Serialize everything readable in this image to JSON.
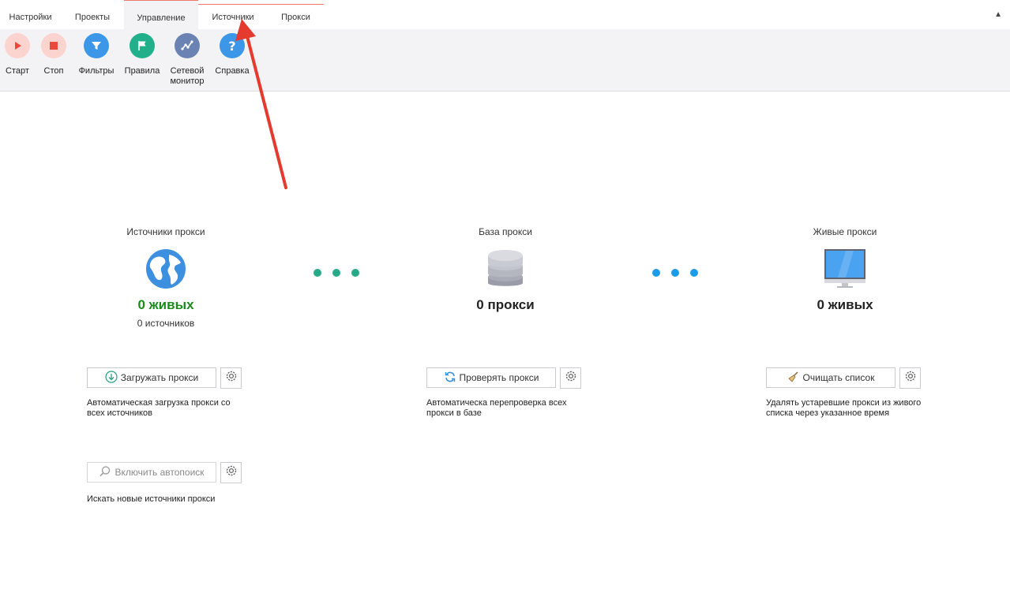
{
  "tabs": [
    "Настройки",
    "Проекты",
    "Управление",
    "Источники",
    "Прокси"
  ],
  "collapse_glyph": "▲",
  "ribbon": {
    "start": "Старт",
    "stop": "Стоп",
    "filters": "Фильтры",
    "rules": "Правила",
    "network_monitor_1": "Сетевой",
    "network_monitor_2": "монитор",
    "help": "Справка"
  },
  "sources": {
    "title": "Источники прокси",
    "alive": "0 живых",
    "count": "0 источников",
    "load_button": "Загружать прокси",
    "load_desc_1": "Автоматическая загрузка прокси со",
    "load_desc_2": "всех источников",
    "autosearch_button": "Включить автопоиск",
    "autosearch_desc": "Искать новые источники прокси"
  },
  "base": {
    "title": "База прокси",
    "count": "0 прокси",
    "check_button": "Проверять прокси",
    "check_desc_1": "Автоматическа перепроверка всех",
    "check_desc_2": "прокси в базе"
  },
  "alive": {
    "title": "Живые прокси",
    "count": "0 живых",
    "clear_button": "Очищать список",
    "clear_desc_1": "Удалять устаревшие прокси из живого",
    "clear_desc_2": "списка через указанное время"
  },
  "colors": {
    "accent": "#f0776a",
    "green": "#1a8a1a",
    "teal_dots": "#27a98a",
    "blue_dots": "#1e9be8",
    "arrow": "#e53b2f"
  }
}
